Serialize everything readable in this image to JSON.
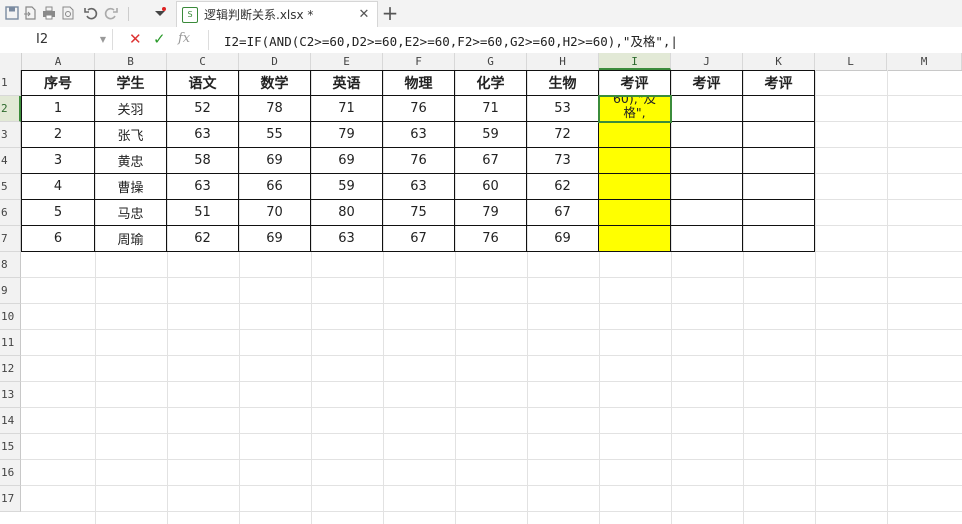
{
  "toolbar": {
    "icons": [
      "save-icon",
      "export-pdf-icon",
      "print-icon",
      "print-preview-icon",
      "undo-icon",
      "redo-icon",
      "customize-dropdown-icon"
    ],
    "tab": {
      "label": "逻辑判断关系.xlsx *",
      "close": "✕"
    },
    "new_tab": "+"
  },
  "formula_bar": {
    "name_box": "I2",
    "cancel": "✕",
    "confirm": "✓",
    "fx": "fx",
    "formula": "I2=IF(AND(C2>=60,D2>=60,E2>=60,F2>=60,G2>=60,H2>=60),\"及格\",|"
  },
  "grid": {
    "column_letters": [
      "A",
      "B",
      "C",
      "D",
      "E",
      "F",
      "G",
      "H",
      "I",
      "J",
      "K",
      "L",
      "M"
    ],
    "row_numbers": [
      "1",
      "2",
      "3",
      "4",
      "5",
      "6",
      "7",
      "8",
      "9",
      "10",
      "11",
      "12",
      "13",
      "14",
      "15",
      "16",
      "17"
    ],
    "active_column": "I",
    "active_row": "2"
  },
  "table": {
    "headers": [
      "序号",
      "学生",
      "语文",
      "数学",
      "英语",
      "物理",
      "化学",
      "生物",
      "考评",
      "考评",
      "考评"
    ],
    "rows": [
      [
        "1",
        "关羽",
        "52",
        "78",
        "71",
        "76",
        "71",
        "53"
      ],
      [
        "2",
        "张飞",
        "63",
        "55",
        "79",
        "63",
        "59",
        "72"
      ],
      [
        "3",
        "黄忠",
        "58",
        "69",
        "69",
        "76",
        "67",
        "73"
      ],
      [
        "4",
        "曹操",
        "63",
        "66",
        "59",
        "63",
        "60",
        "62"
      ],
      [
        "5",
        "马忠",
        "51",
        "70",
        "80",
        "75",
        "79",
        "67"
      ],
      [
        "6",
        "周瑜",
        "62",
        "69",
        "63",
        "67",
        "76",
        "69"
      ]
    ],
    "active_cell_text": [
      "60),\"及",
      "格\","
    ],
    "highlight_color": "#ffff00",
    "active_color": "#3b8c3b"
  }
}
